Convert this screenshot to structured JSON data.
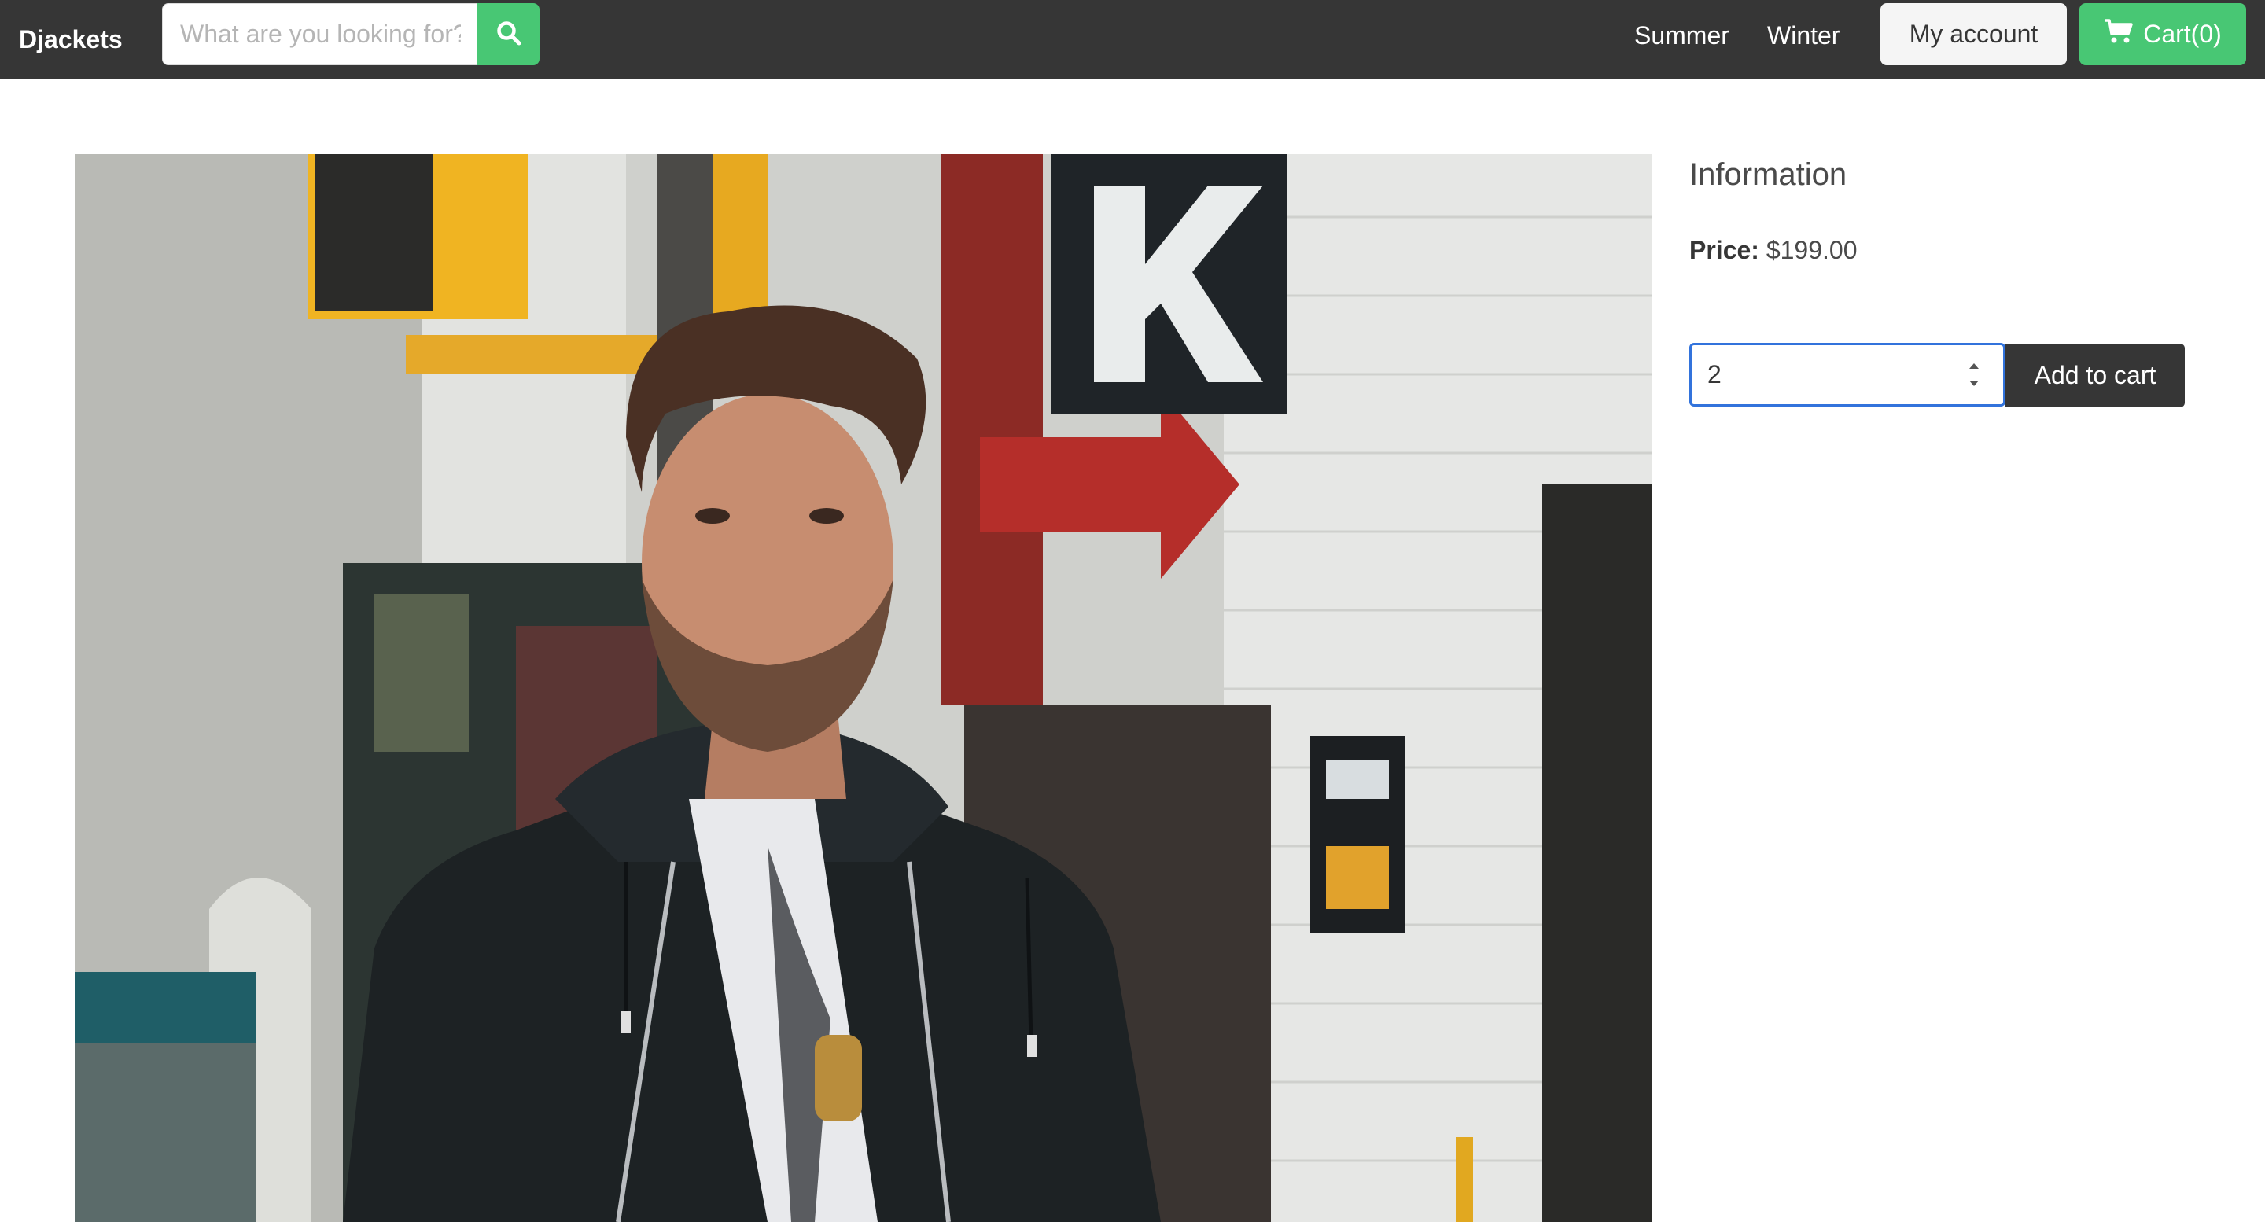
{
  "navbar": {
    "brand": "Djackets",
    "search": {
      "placeholder": "What are you looking for?",
      "button_icon": "search-icon"
    },
    "links": [
      "Summer",
      "Winter"
    ],
    "account_label": "My account",
    "cart": {
      "label": "Cart(0)",
      "icon": "shopping-cart-icon"
    }
  },
  "product": {
    "image_alt": "Man wearing black leather jacket with hood",
    "info_title": "Information",
    "price_label": "Price:",
    "price_value": "$199.00",
    "quantity_value": "2",
    "add_to_cart_label": "Add to cart"
  },
  "colors": {
    "navbar_bg": "#363636",
    "accent_green": "#48c774",
    "focus_blue": "#3273dc",
    "dark_button": "#363636"
  }
}
